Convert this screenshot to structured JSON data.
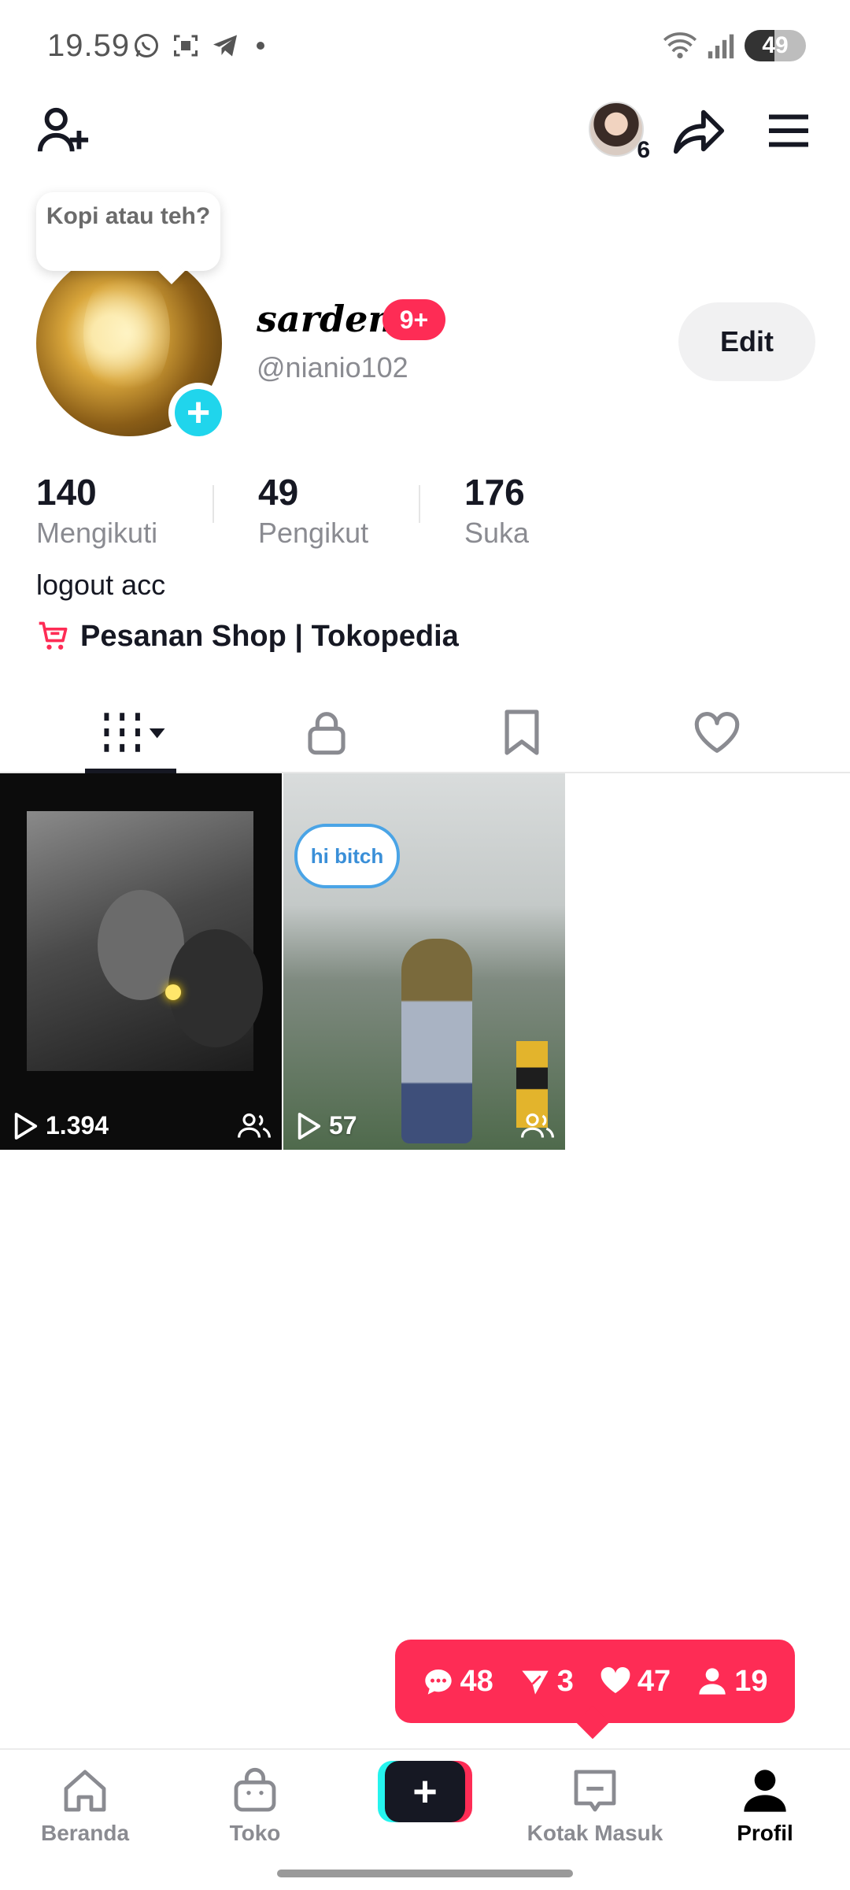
{
  "status_bar": {
    "time": "19.59",
    "battery": "49",
    "battery_level": 0.49
  },
  "top_nav": {
    "friend_count": "6"
  },
  "profile": {
    "tooltip": "Kopi atau teh?",
    "nickname": "sarden",
    "notification_badge": "9+",
    "username": "@nianio102",
    "edit_label": "Edit",
    "stats": [
      {
        "value": "140",
        "label": "Mengikuti"
      },
      {
        "value": "49",
        "label": "Pengikut"
      },
      {
        "value": "176",
        "label": "Suka"
      }
    ],
    "bio": "logout acc",
    "shop_link": "Pesanan Shop | Tokopedia"
  },
  "tabs": [
    {
      "name": "videos",
      "icon": "grid-icon"
    },
    {
      "name": "private",
      "icon": "lock-icon"
    },
    {
      "name": "saved",
      "icon": "bookmark-icon"
    },
    {
      "name": "liked",
      "icon": "heart-icon"
    }
  ],
  "videos": [
    {
      "views": "1.394",
      "sticker": ""
    },
    {
      "views": "57",
      "sticker": "hi bitch"
    }
  ],
  "activity": {
    "comments": "48",
    "shares": "3",
    "likes": "47",
    "followers": "19"
  },
  "bottom_nav": [
    {
      "label": "Beranda",
      "icon": "home-icon"
    },
    {
      "label": "Toko",
      "icon": "shopping-bag-icon"
    },
    {
      "label": "",
      "icon": "plus-icon"
    },
    {
      "label": "Kotak Masuk",
      "icon": "inbox-icon"
    },
    {
      "label": "Profil",
      "icon": "person-icon"
    }
  ],
  "colors": {
    "accent": "#fe2c55",
    "cyan": "#25f4ee",
    "text_primary": "#161823",
    "text_secondary": "#8a8b91"
  }
}
